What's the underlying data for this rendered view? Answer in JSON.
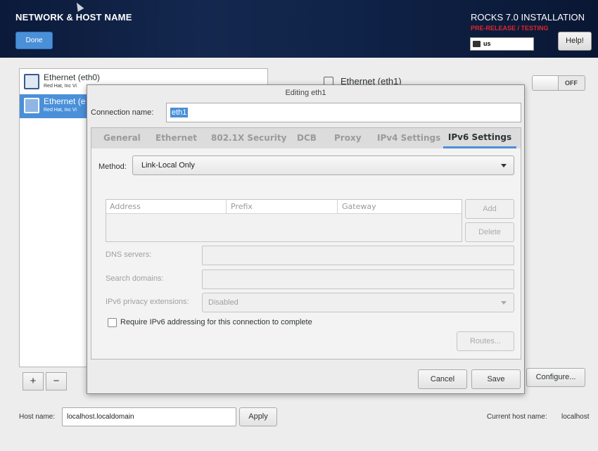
{
  "header": {
    "title": "NETWORK & HOST NAME",
    "done_label": "Done",
    "product": "ROCKS 7.0 INSTALLATION",
    "prerelease": "PRE-RELEASE / TESTING",
    "keyboard_layout": "us",
    "help_label": "Help!"
  },
  "devices": [
    {
      "name": "Ethernet (eth0)",
      "vendor": "Red Hat, Inc Vi",
      "selected": false
    },
    {
      "name": "Ethernet (e",
      "vendor": "Red Hat, Inc Vi",
      "selected": true
    }
  ],
  "list_tools": {
    "add": "+",
    "remove": "−"
  },
  "interface_panel": {
    "title": "Ethernet (eth1)",
    "toggle_label": "OFF",
    "configure_label": "Configure..."
  },
  "hostname": {
    "label": "Host name:",
    "value": "localhost.localdomain",
    "apply_label": "Apply",
    "current_label": "Current host name:",
    "current_value": "localhost"
  },
  "dialog": {
    "title": "Editing eth1",
    "connection_name_label": "Connection name:",
    "connection_name_value": "eth1",
    "tabs": [
      "General",
      "Ethernet",
      "802.1X Security",
      "DCB",
      "Proxy",
      "IPv4 Settings",
      "IPv6 Settings"
    ],
    "active_tab": "IPv6 Settings",
    "method_label": "Method:",
    "method_value": "Link-Local Only",
    "address_columns": [
      "Address",
      "Prefix",
      "Gateway"
    ],
    "add_label": "Add",
    "delete_label": "Delete",
    "dns_label": "DNS servers:",
    "search_label": "Search domains:",
    "privacy_label": "IPv6 privacy extensions:",
    "privacy_value": "Disabled",
    "require_label": "Require IPv6 addressing for this connection to complete",
    "require_checked": false,
    "routes_label": "Routes...",
    "cancel_label": "Cancel",
    "save_label": "Save"
  },
  "colors": {
    "accent": "#4a90d9",
    "prerelease": "#e0262e",
    "header_bg": "#0b1a3a"
  }
}
